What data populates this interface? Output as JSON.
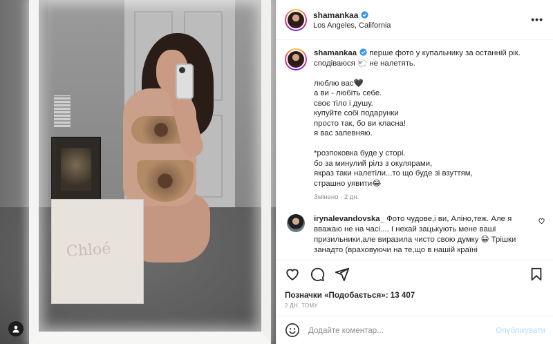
{
  "post": {
    "username": "shamankaa",
    "location": "Los Angeles, California",
    "more_icon": "more-horizontal-icon",
    "photo": {
      "box_label": "Chloé"
    }
  },
  "caption": {
    "username": "shamankaa",
    "lines": [
      "перше фото у купальнику за останній рік.",
      "сподіваюся 🐑 не налетять.",
      "",
      "люблю вас🖤",
      "а ви - любіть себе.",
      "своє тіло і душу.",
      "купуйте собі подарунки",
      "просто так, бо ви класна!",
      "я вас запевняю.",
      "",
      "*розпоковка буде у сторі.",
      "бо за минулий рілз з окулярами,",
      "якраз таки налетіли...то що буде зі взуттям,",
      "страшно уявити😂"
    ],
    "edited": "Змінено · 2 дн."
  },
  "comment": {
    "username": "irynalevandovska_",
    "text": "Фото чудове,і ви, Аліно,теж. Але я вважаю не на часі.... І нехай зацькують мене ваші призильники,але виразила чисто свою думку 😀 Трішки занадто (враховуючи на те,що в нашій країні"
  },
  "actions": {
    "likes_label": "Позначки «Подобається»:",
    "likes_count": "13 407",
    "time_ago": "2 ДН. ТОМУ"
  },
  "add_comment": {
    "placeholder": "Додайте коментар...",
    "post_label": "Опублікувати"
  },
  "colors": {
    "verified": "#3897f0",
    "post_button_disabled": "#b2dffc",
    "meta_text": "#8e8e8e"
  }
}
